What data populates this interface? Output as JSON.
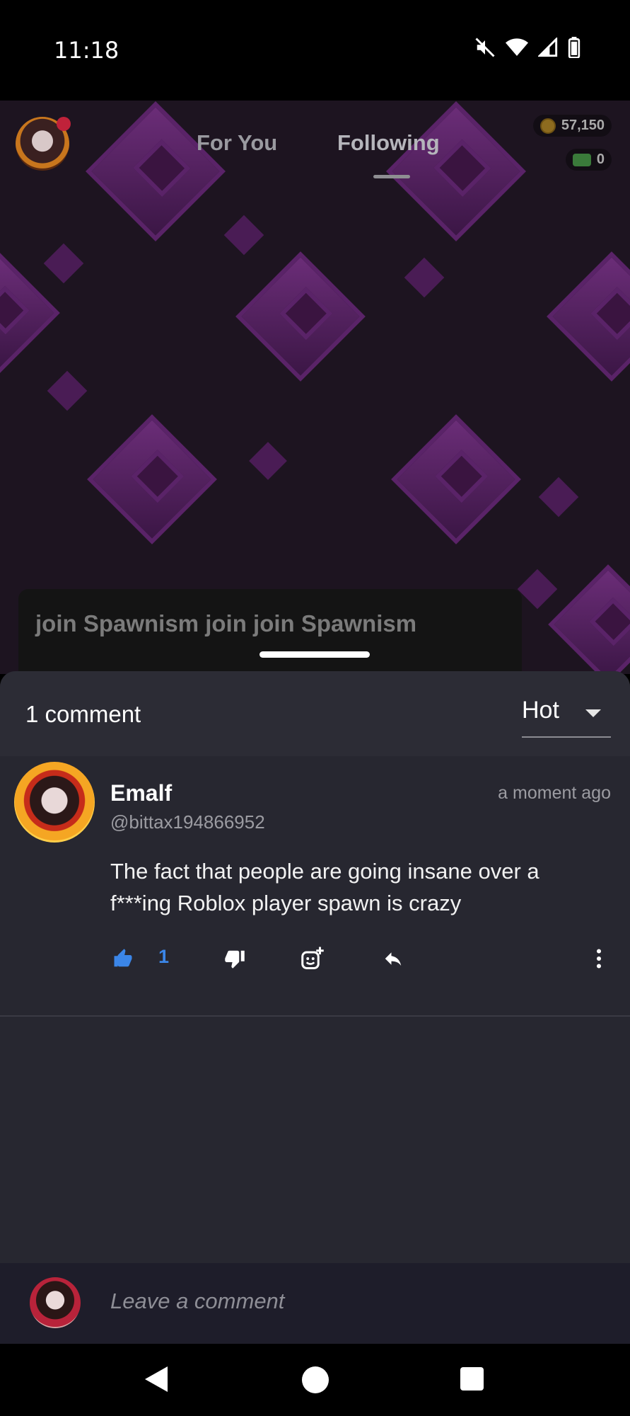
{
  "status_bar": {
    "time": "11:18",
    "icons": [
      "mute-icon",
      "wifi-icon",
      "signal-icon",
      "battery-icon"
    ]
  },
  "feed": {
    "tabs": [
      {
        "label": "For You",
        "active": false
      },
      {
        "label": "Following",
        "active": true
      }
    ],
    "coins": "57,150",
    "cash": "0",
    "caption": "join Spawnism join join Spawnism"
  },
  "comments": {
    "count_label": "1 comment",
    "sort": {
      "selected": "Hot"
    },
    "items": [
      {
        "name": "Emalf",
        "handle": "@bittax194866952",
        "time": "a moment ago",
        "body": "The fact that people are going insane over a f***ing Roblox player spawn is crazy",
        "likes": "1"
      }
    ]
  },
  "compose": {
    "placeholder": "Leave a comment"
  },
  "colors": {
    "accent_like": "#3b86e8",
    "sheet_bg": "#272730",
    "feed_bg": "#1d1420"
  }
}
